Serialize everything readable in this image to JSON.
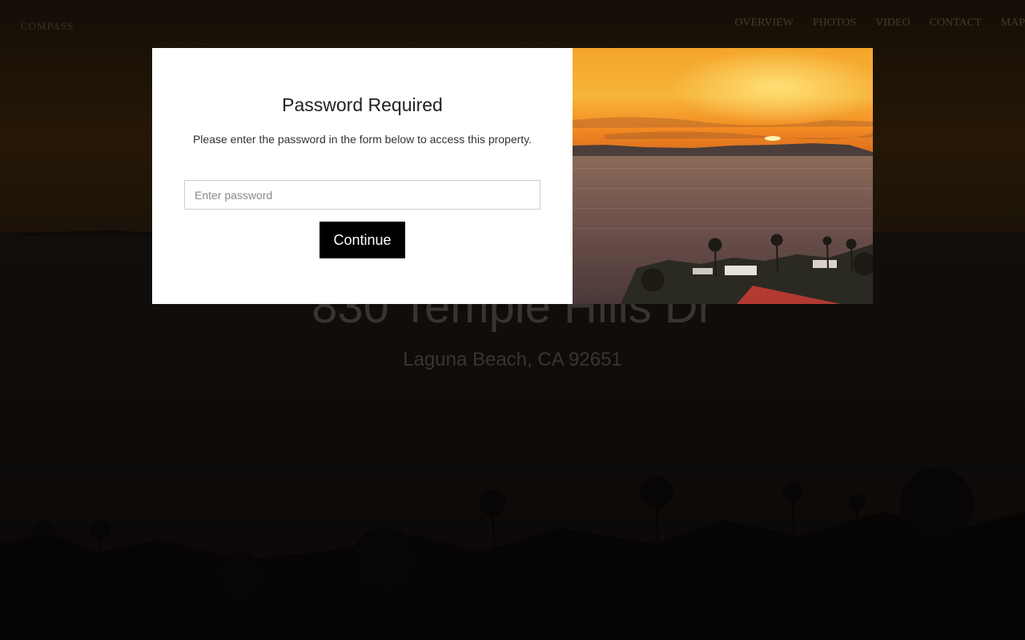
{
  "site": {
    "brand": "COMPASS",
    "nav": [
      {
        "label": "OVERVIEW"
      },
      {
        "label": "PHOTOS"
      },
      {
        "label": "VIDEO"
      },
      {
        "label": "CONTACT"
      },
      {
        "label": "MAP"
      }
    ]
  },
  "hero": {
    "address": "830 Temple Hills Dr",
    "city": "Laguna Beach, CA 92651"
  },
  "modal": {
    "title": "Password Required",
    "description": "Please enter the password in the form below to access this property.",
    "password_placeholder": "Enter password",
    "password_value": "",
    "continue_label": "Continue",
    "image_alt": "Sunset over the ocean with palm trees"
  },
  "colors": {
    "modal_background": "#ffffff",
    "button_background": "#000000",
    "button_text": "#ffffff",
    "sunset_orange": "#f5a623"
  }
}
